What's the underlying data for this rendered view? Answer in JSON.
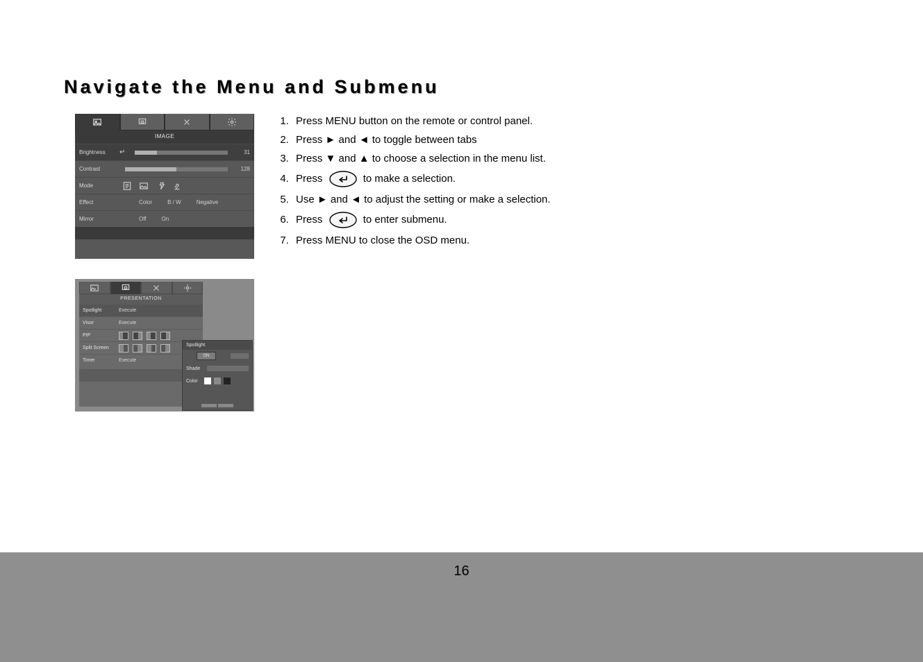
{
  "heading": "Navigate the Menu and Submenu",
  "page_number": "16",
  "osd_image": {
    "title": "IMAGE",
    "brightness_label": "Brightness",
    "brightness_value": "31",
    "contrast_label": "Contrast",
    "contrast_value": "128",
    "mode_label": "Mode",
    "effect_label": "Effect",
    "effect_opts": {
      "a": "Color",
      "b": "B / W",
      "c": "Negative"
    },
    "mirror_label": "Mirror",
    "mirror_opts": {
      "a": "Off",
      "b": "On"
    }
  },
  "osd_presentation": {
    "title": "PRESENTATION",
    "spotlight_label": "Spotlight",
    "spotlight_value": "Execute",
    "visor_label": "Visor",
    "visor_value": "Execute",
    "pip_label": "PIP",
    "split_label": "Split Screen",
    "timer_label": "Timer",
    "timer_value": "Execute",
    "sub_title": "Spotlight",
    "sub_on": "ON",
    "sub_shade": "Shade",
    "sub_color": "Color",
    "swatch1": "#ffffff",
    "swatch2": "#8a8a8a",
    "swatch3": "#222222"
  },
  "steps": {
    "s1": "Press MENU button on the remote or control panel.",
    "s2": "Press ► and ◄ to toggle between tabs",
    "s3": "Press ▼ and ▲ to choose a selection in the menu list.",
    "s4a": "Press ",
    "s4b": " to make a selection.",
    "s5": "Use ► and ◄ to adjust the setting or make a selection.",
    "s6a": "Press ",
    "s6b": " to enter submenu.",
    "s7": "Press MENU to close the OSD menu."
  }
}
